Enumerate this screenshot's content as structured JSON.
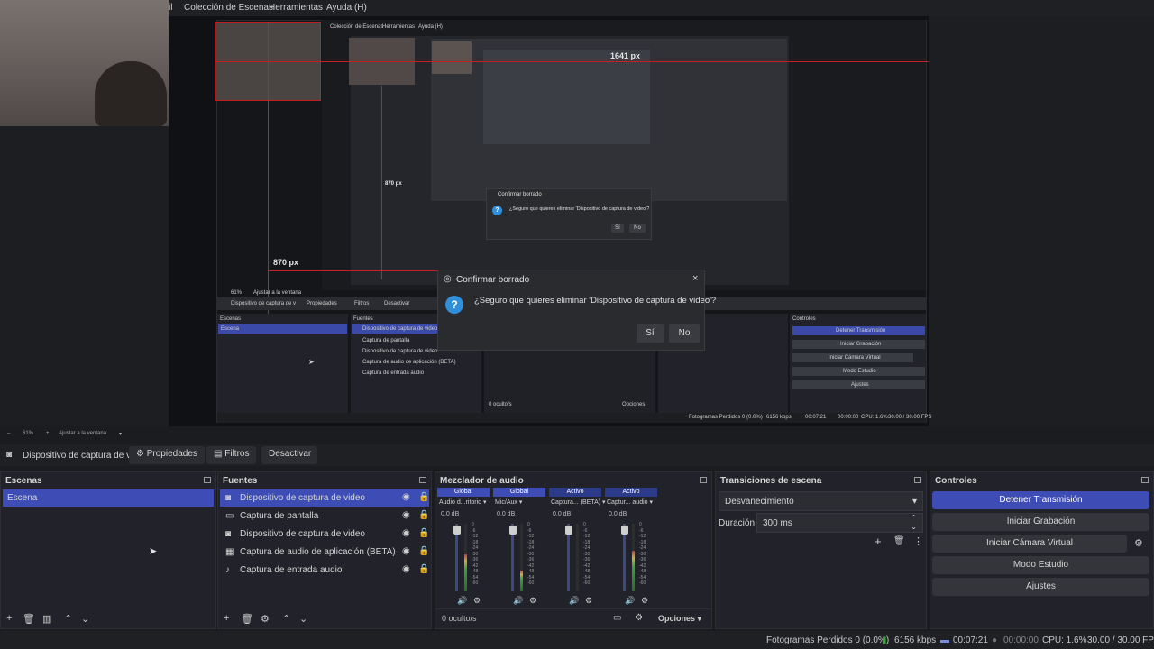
{
  "menu": {
    "partial_item": "il",
    "items": [
      "Colección de Escenas",
      "Herramientas",
      "Ayuda (H)"
    ]
  },
  "preview": {
    "measure_1": "1641 px",
    "measure_2": "870 px",
    "measure_3": "870 px",
    "nested_menu": [
      "Colección de Escenas",
      "Herramientas",
      "Ayuda (H)"
    ],
    "nested_source": "Dispositivo de captura de v",
    "nested_props": "Propiedades",
    "nested_filters": "Filtros",
    "nested_deactivate": "Desactivar",
    "nested_scenes_title": "Escenas",
    "nested_scene": "Escena",
    "nested_sources_title": "Fuentes",
    "nested_sources": [
      "Dispositivo de captura de video",
      "Captura de pantalla",
      "Dispositivo de captura de video",
      "Captura de audio de aplicación (BETA)",
      "Captura de entrada audio"
    ],
    "nested_controls_title": "Controles",
    "nested_controls": [
      "Detener Transmisión",
      "Iniciar Grabación",
      "Iniciar Cámara Virtual",
      "Modo Estudio",
      "Ajustes"
    ],
    "nested_status": [
      "Fotogramas Perdidos 0 (0.0%)",
      "6156 kbps",
      "00:07:21",
      "00:00:00",
      "CPU: 1.6%",
      "30.00 / 30.00 FPS"
    ],
    "nested_hidden": "0 oculto/s",
    "nested_options": "Opciones",
    "nested_zoom": "61%",
    "nested_fit": "Ajustar a la ventana",
    "dialog_small_title": "Confirmar borrado",
    "dialog_small_text": "¿Seguro que quieres eliminar 'Dispositivo de captura de video'?",
    "dialog_small_yes": "Sí",
    "dialog_small_no": "No"
  },
  "dialog": {
    "title": "Confirmar borrado",
    "message": "¿Seguro que quieres eliminar 'Dispositivo de captura de video'?",
    "yes": "Sí",
    "no": "No",
    "close": "×",
    "question_mark": "?"
  },
  "zoom": {
    "minus": "–",
    "level": "61%",
    "plus": "+",
    "fit": "Ajustar a la ventana"
  },
  "source_toolbar": {
    "source_name": "Dispositivo de captura de v",
    "properties": "Propiedades",
    "filters": "Filtros",
    "deactivate": "Desactivar"
  },
  "scenes": {
    "title": "Escenas",
    "items": [
      "Escena"
    ]
  },
  "sources": {
    "title": "Fuentes",
    "items": [
      {
        "label": "Dispositivo de captura de video",
        "icon": "camera-icon"
      },
      {
        "label": "Captura de pantalla",
        "icon": "monitor-icon"
      },
      {
        "label": "Dispositivo de captura de video",
        "icon": "camera-icon"
      },
      {
        "label": "Captura de audio de aplicación (BETA)",
        "icon": "app-audio-icon"
      },
      {
        "label": "Captura de entrada audio",
        "icon": "mic-icon"
      }
    ]
  },
  "mixer": {
    "title": "Mezclador de audio",
    "channels": [
      {
        "tag": "Global",
        "name": "Audio d...ritorio",
        "db": "0.0 dB",
        "level": 0.55
      },
      {
        "tag": "Global",
        "name": "Mic/Aux",
        "db": "0.0 dB",
        "level": 0.3
      },
      {
        "tag": "Activo",
        "name": "Captura... (BETA)",
        "db": "0.0 dB",
        "level": 0.0
      },
      {
        "tag": "Activo",
        "name": "Captur... audio",
        "db": "0.0 dB",
        "level": 0.6
      }
    ],
    "scale": [
      "0",
      "-6",
      "-12",
      "-18",
      "-24",
      "-30",
      "-36",
      "-42",
      "-48",
      "-54",
      "-60"
    ],
    "hidden": "0 oculto/s",
    "options": "Opciones"
  },
  "transitions": {
    "title": "Transiciones de escena",
    "selected": "Desvanecimiento",
    "duration_label": "Duración",
    "duration_value": "300 ms"
  },
  "controls": {
    "title": "Controles",
    "stop_stream": "Detener Transmisión",
    "start_record": "Iniciar Grabación",
    "virtual_cam": "Iniciar Cámara Virtual",
    "studio_mode": "Modo Estudio",
    "settings": "Ajustes"
  },
  "status": {
    "dropped": "Fotogramas Perdidos 0 (0.0%)",
    "bitrate": "6156 kbps",
    "stream_time": "00:07:21",
    "record_time": "00:00:00",
    "cpu": "CPU: 1.6%",
    "fps": "30.00 / 30.00 FPS"
  },
  "colors": {
    "accent": "#3d4db5",
    "guide": "#c42020",
    "background": "#1b1c20"
  }
}
